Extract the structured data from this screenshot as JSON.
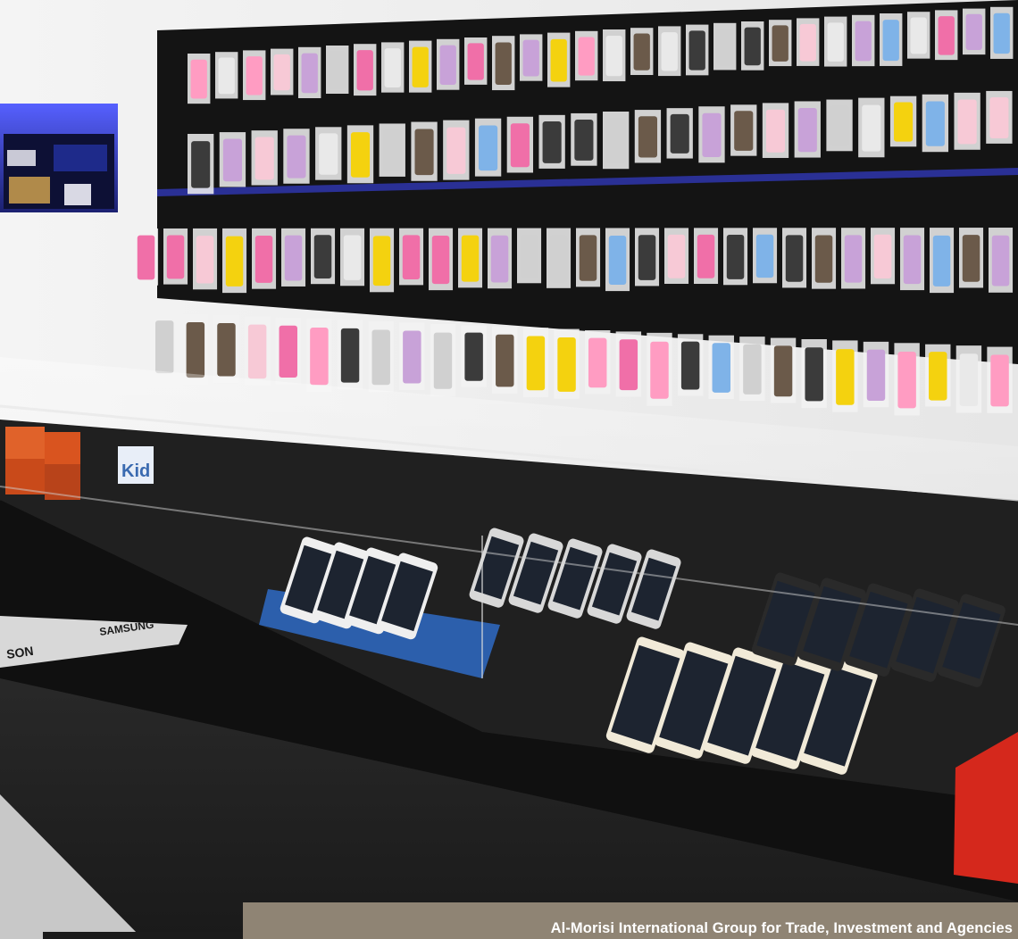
{
  "photo": {
    "subject": "mobile-phone-accessory-store",
    "colors": {
      "wall": "#efefef",
      "display_panel": "#151515",
      "glass_counter": "#1a1a1a",
      "floor": "#2a2a2a",
      "blue_niche": "#3a43c8",
      "caption_band": "#8f8474"
    },
    "signage": {
      "kids_sign": "Kid",
      "counter_brands": [
        "SAMSUNG",
        "SON"
      ]
    }
  },
  "caption": {
    "text": "Al-Morisi International Group for Trade, Investment and Agencies"
  }
}
